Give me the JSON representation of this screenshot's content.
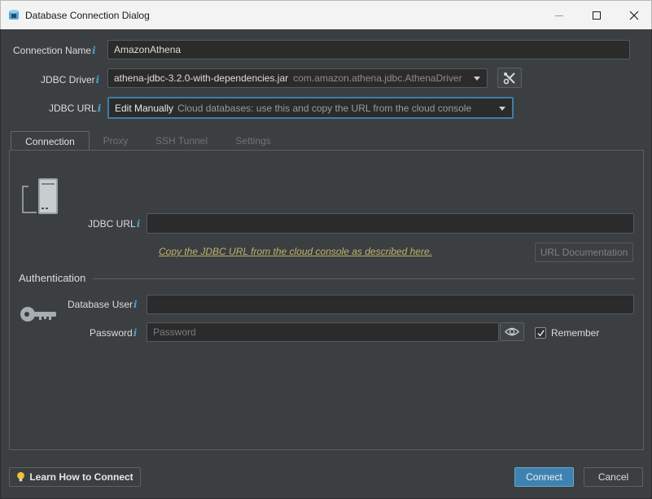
{
  "window": {
    "title": "Database Connection Dialog"
  },
  "form": {
    "connection_name_label": "Connection Name",
    "connection_name_value": "AmazonAthena",
    "jdbc_driver_label": "JDBC Driver",
    "jdbc_driver_value": "athena-jdbc-3.2.0-with-dependencies.jar",
    "jdbc_driver_class": "com.amazon.athena.jdbc.AthenaDriver",
    "jdbc_url_label": "JDBC URL",
    "jdbc_url_mode": "Edit Manually",
    "jdbc_url_mode_hint": "Cloud databases: use this and copy the URL from the cloud console"
  },
  "tabs": [
    {
      "label": "Connection",
      "active": true
    },
    {
      "label": "Proxy",
      "active": false
    },
    {
      "label": "SSH Tunnel",
      "active": false
    },
    {
      "label": "Settings",
      "active": false
    }
  ],
  "connection_tab": {
    "jdbc_url_label": "JDBC URL",
    "jdbc_url_value": "",
    "copy_link": "Copy the JDBC URL from the cloud console as described here.",
    "url_doc_button": "URL Documentation",
    "auth_title": "Authentication",
    "db_user_label": "Database User",
    "db_user_value": "",
    "password_label": "Password",
    "password_placeholder": "Password",
    "remember_label": "Remember",
    "remember_checked": true
  },
  "footer": {
    "learn_button": "Learn How to Connect",
    "connect_button": "Connect",
    "cancel_button": "Cancel"
  },
  "icons": {
    "app": "database-app-icon",
    "info": "i",
    "tools": "wrench-screwdriver-icon",
    "server": "server-icon",
    "key": "key-icon",
    "eye": "eye-icon",
    "bulb": "lightbulb-icon"
  },
  "colors": {
    "accent": "#3e82b2",
    "info": "#4aa3c9",
    "link": "#c2b16a"
  }
}
